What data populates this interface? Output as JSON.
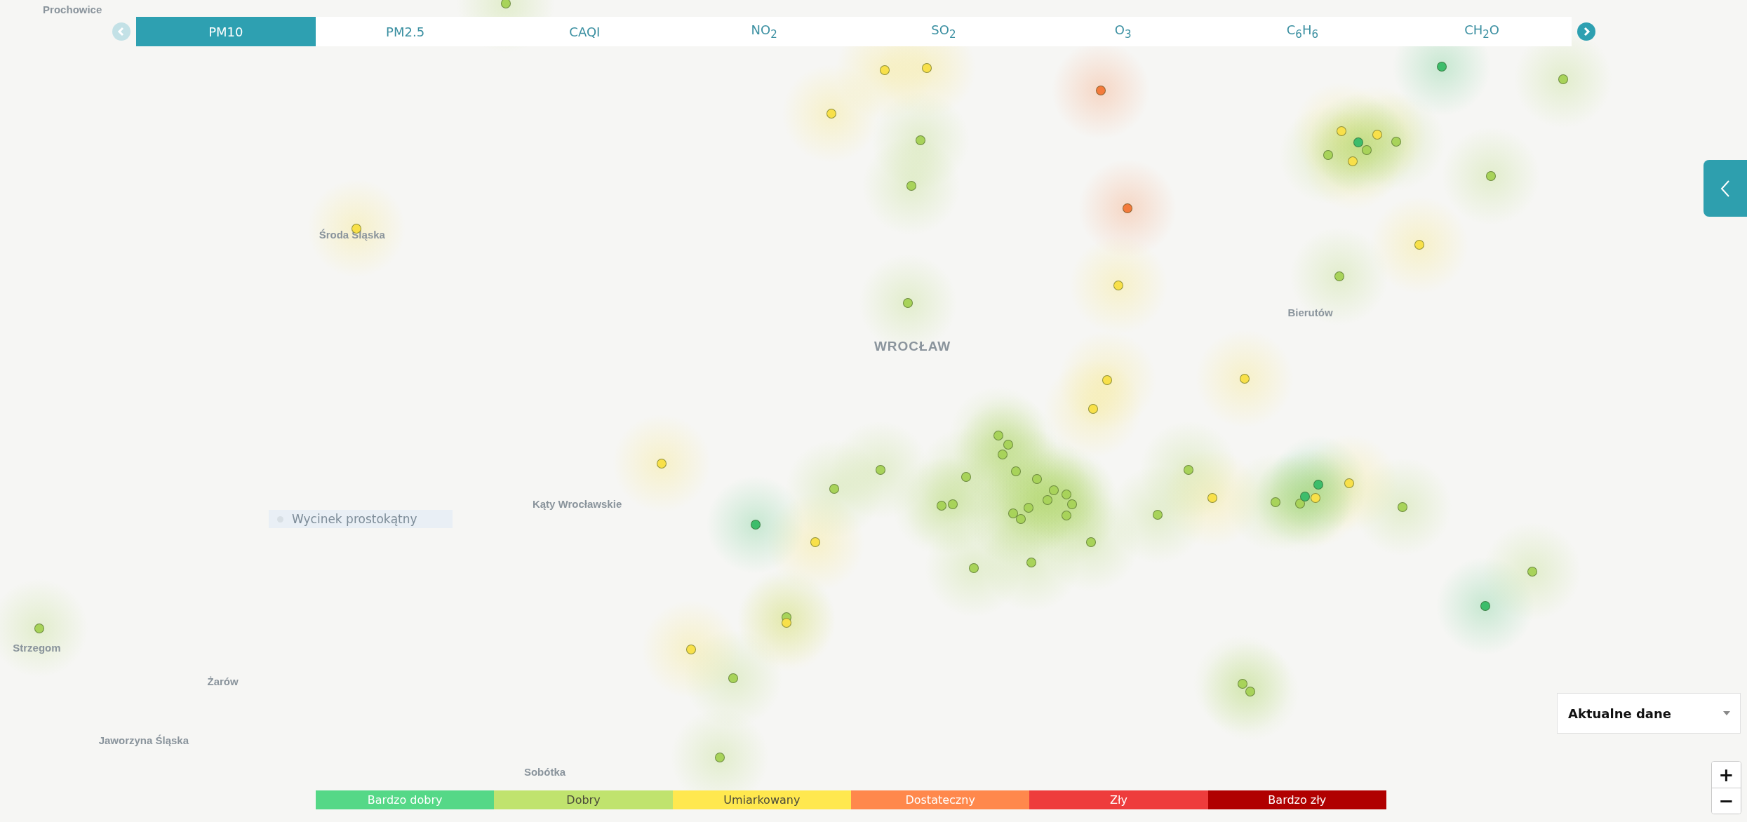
{
  "tabs": [
    {
      "label": "PM10",
      "selected": true
    },
    {
      "label": "PM2.5",
      "selected": false
    },
    {
      "label": "CAQI",
      "selected": false
    },
    {
      "label": "NO$_{2}$",
      "selected": false
    },
    {
      "label": "SO$_{2}$",
      "selected": false
    },
    {
      "label": "O$_{3}$",
      "selected": false
    },
    {
      "label": "C$_{6}$H$_{6}$",
      "selected": false
    },
    {
      "label": "CH$_{2}$O",
      "selected": false
    }
  ],
  "tab_prev": {
    "disabled": true
  },
  "tab_next": {
    "disabled": false
  },
  "map_labels": [
    {
      "text": "Prochowice",
      "kind": "town"
    },
    {
      "text": "Środa Śląska",
      "kind": "town"
    },
    {
      "text": "WROCŁAW",
      "kind": "city"
    },
    {
      "text": "Bierutów",
      "kind": "town"
    },
    {
      "text": "Kąty Wrocławskie",
      "kind": "town"
    },
    {
      "text": "Strzegom",
      "kind": "town"
    },
    {
      "text": "Żarów",
      "kind": "town"
    },
    {
      "text": "Jaworzyna Śląska",
      "kind": "town"
    },
    {
      "text": "Sobótka",
      "kind": "town"
    }
  ],
  "selection_tool": {
    "label": "Wycinek prostokątny"
  },
  "sensors": [
    {
      "color": "#a8d35a"
    },
    {
      "color": "#f8e04a"
    },
    {
      "color": "#f8e04a"
    },
    {
      "color": "#f8e04a"
    },
    {
      "color": "#a8d35a"
    },
    {
      "color": "#a8d35a"
    },
    {
      "color": "#f47b3c"
    },
    {
      "color": "#f47b3c"
    },
    {
      "color": "#f8e04a"
    },
    {
      "color": "#a8d35a"
    },
    {
      "color": "#3dbd6b"
    },
    {
      "color": "#a8d35a"
    },
    {
      "color": "#f8e04a"
    },
    {
      "color": "#3dbd6b"
    },
    {
      "color": "#f8e04a"
    },
    {
      "color": "#a8d35a"
    },
    {
      "color": "#a8d35a"
    },
    {
      "color": "#f8e04a"
    },
    {
      "color": "#a8d35a"
    },
    {
      "color": "#a8d35a"
    },
    {
      "color": "#f8e04a"
    },
    {
      "color": "#a8d35a"
    },
    {
      "color": "#f8e04a"
    },
    {
      "color": "#f8e04a"
    },
    {
      "color": "#f8e04a"
    },
    {
      "color": "#f8e04a"
    },
    {
      "color": "#f8e04a"
    },
    {
      "color": "#a8d35a"
    },
    {
      "color": "#a8d35a"
    },
    {
      "color": "#3dbd6b"
    },
    {
      "color": "#f8e04a"
    },
    {
      "color": "#a8d35a"
    },
    {
      "color": "#a8d35a"
    },
    {
      "color": "#a8d35a"
    },
    {
      "color": "#a8d35a"
    },
    {
      "color": "#a8d35a"
    },
    {
      "color": "#a8d35a"
    },
    {
      "color": "#a8d35a"
    },
    {
      "color": "#a8d35a"
    },
    {
      "color": "#a8d35a"
    },
    {
      "color": "#a8d35a"
    },
    {
      "color": "#a8d35a"
    },
    {
      "color": "#a8d35a"
    },
    {
      "color": "#a8d35a"
    },
    {
      "color": "#a8d35a"
    },
    {
      "color": "#a8d35a"
    },
    {
      "color": "#a8d35a"
    },
    {
      "color": "#a8d35a"
    },
    {
      "color": "#a8d35a"
    },
    {
      "color": "#a8d35a"
    },
    {
      "color": "#a8d35a"
    },
    {
      "color": "#a8d35a"
    },
    {
      "color": "#f8e04a"
    },
    {
      "color": "#a8d35a"
    },
    {
      "color": "#a8d35a"
    },
    {
      "color": "#3dbd6b"
    },
    {
      "color": "#f8e04a"
    },
    {
      "color": "#3dbd6b"
    },
    {
      "color": "#f8e04a"
    },
    {
      "color": "#a8d35a"
    },
    {
      "color": "#a8d35a"
    },
    {
      "color": "#3dbd6b"
    },
    {
      "color": "#a8d35a"
    },
    {
      "color": "#a8d35a"
    },
    {
      "color": "#f8e04a"
    },
    {
      "color": "#f8e04a"
    },
    {
      "color": "#a8d35a"
    },
    {
      "color": "#a8d35a"
    },
    {
      "color": "#a8d35a"
    },
    {
      "color": "#a8d35a"
    }
  ],
  "side_panel_toggle": {
    "expanded": false
  },
  "data_select": {
    "value": "Aktualne dane"
  },
  "zoom": {
    "in": "+",
    "out": "−"
  },
  "legend": [
    {
      "label": "Bardzo dobry",
      "color": "#55d887"
    },
    {
      "label": "Dobry",
      "color": "#c0e36e"
    },
    {
      "label": "Umiarkowany",
      "color": "#ffe84f"
    },
    {
      "label": "Dostateczny",
      "color": "#ff884c"
    },
    {
      "label": "Zły",
      "color": "#ee3c3c"
    },
    {
      "label": "Bardzo zły",
      "color": "#b00000"
    }
  ]
}
